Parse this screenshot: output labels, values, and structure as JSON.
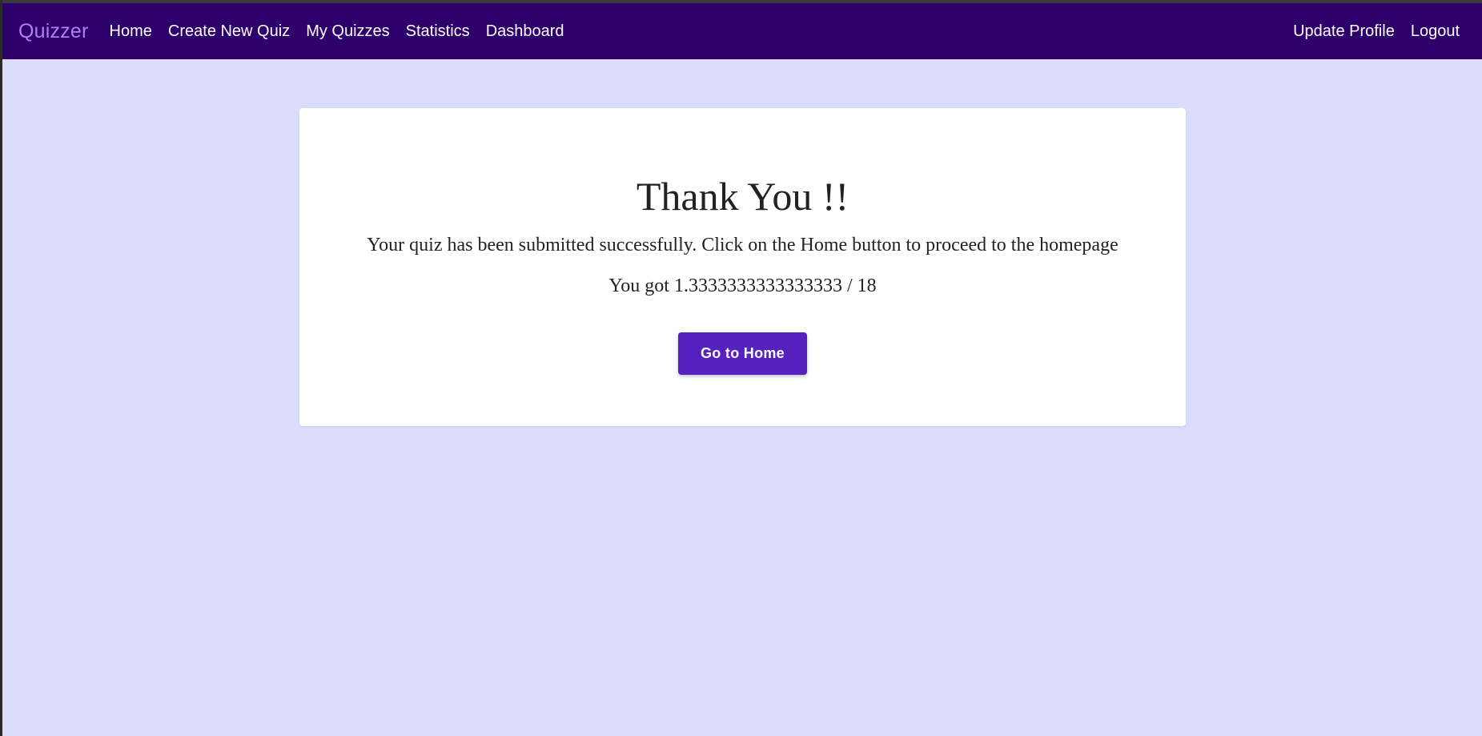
{
  "navbar": {
    "brand": "Quizzer",
    "links": [
      {
        "label": "Home"
      },
      {
        "label": "Create New Quiz"
      },
      {
        "label": "My Quizzes"
      },
      {
        "label": "Statistics"
      },
      {
        "label": "Dashboard"
      }
    ],
    "right_links": [
      {
        "label": "Update Profile"
      },
      {
        "label": "Logout"
      }
    ]
  },
  "result_card": {
    "heading": "Thank You !!",
    "message": "Your quiz has been submitted successfully. Click on the Home button to proceed to the homepage",
    "score_text": "You got 1.3333333333333333 / 18",
    "button_label": "Go to Home"
  },
  "colors": {
    "navbar_bg": "#2d006b",
    "brand": "#b47cf8",
    "page_bg": "#dcdcfd",
    "button_bg": "#5522c0"
  }
}
